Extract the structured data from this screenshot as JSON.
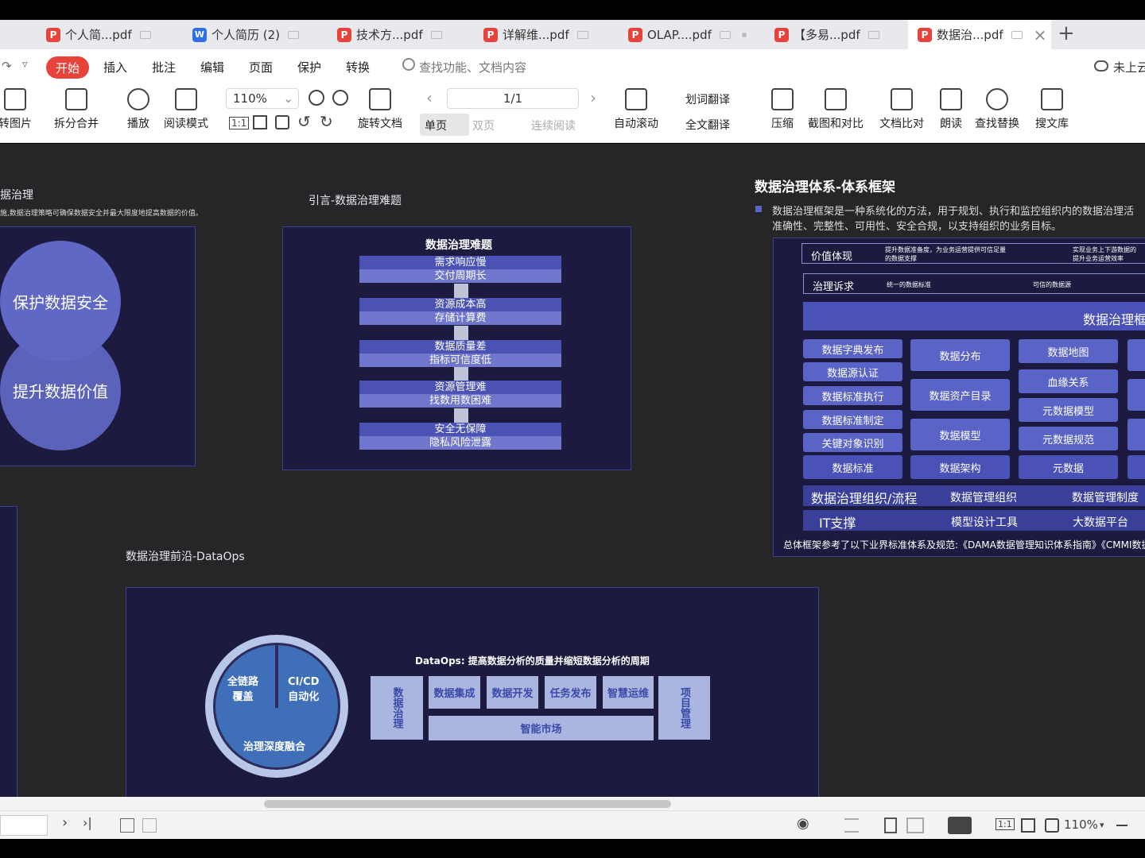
{
  "tabs": [
    {
      "label": "个人简...pdf",
      "type": "pdf"
    },
    {
      "label": "个人简历 (2)",
      "type": "wps"
    },
    {
      "label": "技术方...pdf",
      "type": "pdf"
    },
    {
      "label": "详解维...pdf",
      "type": "pdf"
    },
    {
      "label": "OLAP....pdf",
      "type": "pdf"
    },
    {
      "label": "【多易...pdf",
      "type": "pdf"
    },
    {
      "label": "数据治...pdf",
      "type": "pdf",
      "active": true
    }
  ],
  "menu": {
    "start": "开始",
    "items": [
      "插入",
      "批注",
      "编辑",
      "页面",
      "保护",
      "转换"
    ],
    "search_placeholder": "查找功能、文档内容",
    "cloud": "未上云"
  },
  "toolbar": {
    "to_image": "转图片",
    "split_merge": "拆分合并",
    "play": "播放",
    "read_mode": "阅读模式",
    "zoom": "110%",
    "rotate": "旋转文档",
    "page": "1/1",
    "single": "单页",
    "double": "双页",
    "continuous": "连续阅读",
    "auto_scroll": "自动滚动",
    "word_translate": "划词翻译",
    "full_translate": "全文翻译",
    "compress": "压缩",
    "screenshot_compare": "截图和对比",
    "doc_compare": "文档比对",
    "read_aloud": "朗读",
    "find_replace": "查找替换",
    "search_lib": "搜文库"
  },
  "doc": {
    "left_title": "据治理",
    "left_sub": "施,数据治理策略可确保数据安全并最大限度地提高数据的价值。",
    "circle_top": "保护数据安全",
    "circle_bottom": "提升数据价值",
    "intro_title": "引言-数据治理难题",
    "difficulty_title": "数据治理难题",
    "difficulties": [
      [
        "需求响应慢",
        "交付周期长"
      ],
      [
        "资源成本高",
        "存储计算费"
      ],
      [
        "数据质量差",
        "指标可信度低"
      ],
      [
        "资源管理难",
        "找数用数困难"
      ],
      [
        "安全无保障",
        "隐私风险泄露"
      ]
    ],
    "fw_title": "数据治理体系-体系框架",
    "fw_desc_1": "数据治理框架是一种系统化的方法，用于规划、执行和监控组织内的数据治理活",
    "fw_desc_2": "准确性、完整性、可用性、安全合规，以支持组织的业务目标。",
    "value_label": "价值体现",
    "value_text_1": "提升数据准备度，为业务运营提供可信足量",
    "value_text_2": "的数据支撑",
    "value_text_3": "实现业务上下游数据的",
    "value_text_4": "提升业务运营效率",
    "appeal_label": "治理诉求",
    "appeal_1": "统一的数据标准",
    "appeal_2": "可信的数据源",
    "framework_banner": "数据治理框",
    "col1": [
      "数据字典发布",
      "数据源认证",
      "数据标准执行",
      "数据标准制定",
      "关键对象识别",
      "数据标准"
    ],
    "col2": [
      "数据分布",
      "数据资产目录",
      "数据模型",
      "数据架构"
    ],
    "col3": [
      "数据地图",
      "血缘关系",
      "元数据模型",
      "元数据规范",
      "元数据"
    ],
    "org_row": [
      "数据治理组织/流程",
      "数据管理组织",
      "数据管理制度"
    ],
    "it_row": [
      "IT支撑",
      "模型设计工具",
      "大数据平台"
    ],
    "fw_footer": "总体框架参考了以下业界标准体系及规范:《DAMA数据管理知识体系指南》《CMMI数据",
    "dataops_title": "数据治理前沿-DataOps",
    "dataops_heading": "DataOps: 提高数据分析的质量并缩短数据分析的周期",
    "cycle": [
      "全链路\n覆盖",
      "CI/CD\n自动化",
      "治理深度融合"
    ],
    "ops_left": "数据治理",
    "ops_right": "项目管理",
    "ops_items": [
      "数据集成",
      "数据开发",
      "任务发布",
      "智慧运维"
    ],
    "ops_market": "智能市场"
  },
  "status": {
    "zoom": "110%"
  }
}
